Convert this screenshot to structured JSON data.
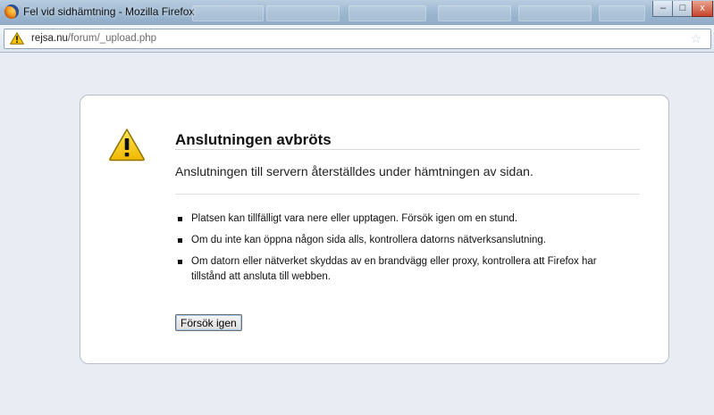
{
  "window": {
    "title": "Fel vid sidhämtning - Mozilla Firefox",
    "controls": {
      "minimize": "–",
      "maximize": "□",
      "close": "x"
    }
  },
  "address": {
    "host": "rejsa.nu",
    "path": "/forum/_upload.php"
  },
  "error": {
    "title": "Anslutningen avbröts",
    "description": "Anslutningen till servern återställdes under hämtningen av sidan.",
    "items": [
      "Platsen kan tillfälligt vara nere eller upptagen. Försök igen om en stund.",
      "Om du inte kan öppna någon sida alls, kontrollera datorns nätverksanslutning.",
      "Om datorn eller nätverket skyddas av en brandvägg eller proxy, kontrollera att Firefox har tillstånd att ansluta till webben."
    ],
    "retry_label": "Försök igen"
  },
  "icons": {
    "app": "firefox-icon",
    "site_warning": "warning-icon",
    "error_warning": "warning-triangle-icon"
  },
  "colors": {
    "titlebar": "#9fb9d2",
    "page_background": "#e9edf3",
    "warning_yellow": "#f5c400"
  }
}
